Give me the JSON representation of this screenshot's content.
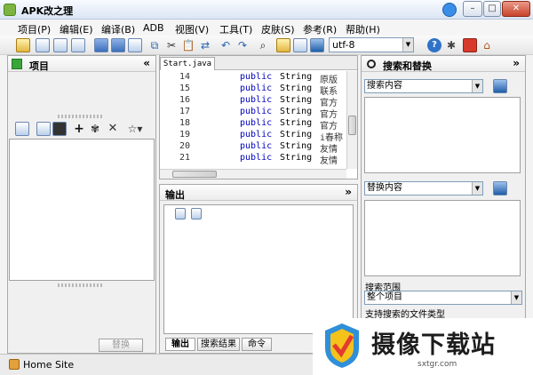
{
  "window": {
    "title": "APK改之理",
    "controls": [
      "–",
      "□",
      "✕"
    ]
  },
  "menu": [
    "项目(P)",
    "编辑(E)",
    "编译(B)",
    "ADB",
    "视图(V)",
    "工具(T)",
    "皮肤(S)",
    "参考(R)",
    "帮助(H)"
  ],
  "toolbar": {
    "encoding": "utf-8",
    "icons": [
      "open-folder-icon",
      "save-icon",
      "save-all-icon",
      "cut-icon",
      "copy-icon",
      "paste-icon",
      "undo-icon",
      "redo-icon",
      "find-icon",
      "help-icon",
      "debug-icon",
      "home-icon"
    ]
  },
  "project_panel": {
    "title": "项目",
    "collapse_glyph": "«",
    "replace_button": "替换"
  },
  "editor": {
    "tab": "Start.java",
    "lines": [
      {
        "num": "14",
        "kw": "public",
        "type": "String",
        "text": "原版"
      },
      {
        "num": "15",
        "kw": "public",
        "type": "String",
        "text": "联系"
      },
      {
        "num": "16",
        "kw": "public",
        "type": "String",
        "text": "官方"
      },
      {
        "num": "17",
        "kw": "public",
        "type": "String",
        "text": "官方"
      },
      {
        "num": "18",
        "kw": "public",
        "type": "String",
        "text": "官方"
      },
      {
        "num": "19",
        "kw": "public",
        "type": "String",
        "text": "i春称"
      },
      {
        "num": "20",
        "kw": "public",
        "type": "String",
        "text": "友情"
      },
      {
        "num": "21",
        "kw": "public",
        "type": "String",
        "text": "友情"
      }
    ]
  },
  "output_panel": {
    "title": "输出",
    "collapse_glyph": "»",
    "tabs": [
      "输出",
      "搜索结果",
      "命令"
    ]
  },
  "search_panel": {
    "title": "搜索和替换",
    "collapse_glyph": "»",
    "search_combo": "搜索内容",
    "replace_combo": "替换内容",
    "scope_label": "搜索范围",
    "scope_value": "整个项目",
    "filetypes_label": "支持搜索的文件类型"
  },
  "status": {
    "text": "Home Site"
  },
  "watermark": {
    "title": "摄像下载站",
    "url": "sxtgr.com"
  },
  "colors": {
    "keyword": "#0000c0",
    "titlebar": "#dbe6f4",
    "accent": "#3b8ee8"
  }
}
